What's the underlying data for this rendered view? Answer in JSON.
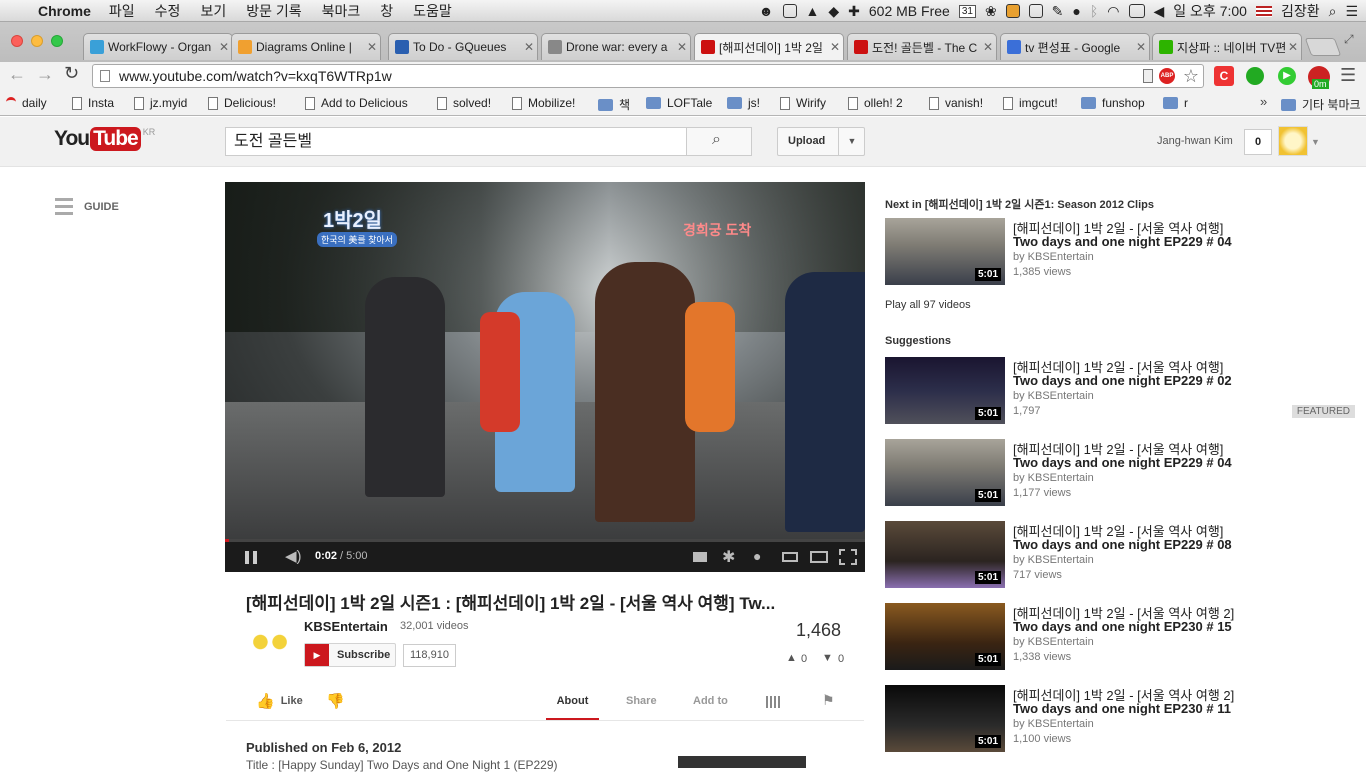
{
  "menubar": {
    "app": "Chrome",
    "items": [
      "파일",
      "수정",
      "보기",
      "방문 기록",
      "북마크",
      "창",
      "도움말"
    ],
    "free_mem": "602 MB Free",
    "calendar_day": "31",
    "clock": "일 오후 7:00",
    "user": "김장환"
  },
  "tabs": [
    {
      "title": "WorkFlowy - Organ",
      "color": "#3aa0d8"
    },
    {
      "title": "Diagrams Online |",
      "color": "#f0a030"
    },
    {
      "title": "To Do - GQueues",
      "color": "#2a5fb0"
    },
    {
      "title": "Drone war: every a",
      "color": "#888888"
    },
    {
      "title": "[해피선데이] 1박 2일",
      "color": "#cc1111"
    },
    {
      "title": "도전! 골든벨 - The C",
      "color": "#cc1111"
    },
    {
      "title": "tv 편성표 - Google",
      "color": "#3b6fd8"
    },
    {
      "title": "지상파 :: 네이버 TV편",
      "color": "#2db400"
    }
  ],
  "omnibox": {
    "url": "www.youtube.com/watch?v=kxqT6WTRp1w"
  },
  "bookmarks": [
    {
      "label": "daily",
      "kind": "page"
    },
    {
      "label": "Insta",
      "kind": "page"
    },
    {
      "label": "jz.myid",
      "kind": "page"
    },
    {
      "label": "Delicious!",
      "kind": "page"
    },
    {
      "label": "Add to Delicious",
      "kind": "page"
    },
    {
      "label": "solved!",
      "kind": "page"
    },
    {
      "label": "Mobilize!",
      "kind": "page"
    },
    {
      "label": "책",
      "kind": "folder"
    },
    {
      "label": "LOFTale",
      "kind": "folder"
    },
    {
      "label": "js!",
      "kind": "folder"
    },
    {
      "label": "Wirify",
      "kind": "page"
    },
    {
      "label": "olleh! 2",
      "kind": "page"
    },
    {
      "label": "vanish!",
      "kind": "page"
    },
    {
      "label": "imgcut!",
      "kind": "page"
    },
    {
      "label": "funshop",
      "kind": "folder"
    },
    {
      "label": "r",
      "kind": "folder"
    }
  ],
  "bookmarks_more": "»",
  "bookmarks_other": "기타 북마크",
  "ext_badge": "0m",
  "yt": {
    "logo_you": "You",
    "logo_tube": "Tube",
    "region": "KR",
    "search_value": "도전 골든벨",
    "upload": "Upload",
    "user_name": "Jang-hwan Kim",
    "notif_count": "0",
    "guide": "GUIDE"
  },
  "player": {
    "time_current": "0:02",
    "time_total": "/ 5:00",
    "overlay_logo": "1박2일",
    "overlay_sub": "한국의 美를 찾아서",
    "overlay_right": "경희궁 도착",
    "progress": 0.007
  },
  "video": {
    "title": "[해피선데이] 1박 2일 시즌1 : [해피선데이] 1박 2일 - [서울 역사 여행] Tw...",
    "channel": "KBSEntertain",
    "channel_videos": "32,001 videos",
    "subscribe": "Subscribe",
    "subscribers": "118,910",
    "views": "1,468",
    "likes": "0",
    "dislikes": "0",
    "like_label": "Like",
    "tabs": [
      "About",
      "Share",
      "Add to"
    ],
    "published": "Published on Feb 6, 2012",
    "desc_line": "Title : [Happy Sunday] Two Days and One Night 1 (EP229)"
  },
  "sidebar": {
    "next_in": "Next in [해피선데이] 1박 2일 시즌1: Season 2012 Clips",
    "play_all": "Play all 97 videos",
    "suggestions_label": "Suggestions",
    "next_item": {
      "t1": "[해피선데이] 1박 2일 - [서울 역사 여행]",
      "t2": "Two days and one night EP229 # 04",
      "by": "by KBSEntertain",
      "views": "1,385 views",
      "dur": "5:01"
    },
    "items": [
      {
        "t1": "[해피선데이] 1박 2일 - [서울 역사 여행]",
        "t2": "Two days and one night EP229 # 02",
        "by": "by KBSEntertain",
        "views": "1,797",
        "dur": "5:01",
        "featured": "FEATURED"
      },
      {
        "t1": "[해피선데이] 1박 2일 - [서울 역사 여행]",
        "t2": "Two days and one night EP229 # 04",
        "by": "by KBSEntertain",
        "views": "1,177 views",
        "dur": "5:01",
        "featured": ""
      },
      {
        "t1": "[해피선데이] 1박 2일 - [서울 역사 여행]",
        "t2": "Two days and one night EP229 # 08",
        "by": "by KBSEntertain",
        "views": "717 views",
        "dur": "5:01",
        "featured": ""
      },
      {
        "t1": "[해피선데이] 1박 2일 - [서울 역사 여행 2]",
        "t2": "Two days and one night EP230 # 15",
        "by": "by KBSEntertain",
        "views": "1,338 views",
        "dur": "5:01",
        "featured": ""
      },
      {
        "t1": "[해피선데이] 1박 2일 - [서울 역사 여행 2]",
        "t2": "Two days and one night EP230 # 11",
        "by": "by KBSEntertain",
        "views": "1,100 views",
        "dur": "5:01",
        "featured": ""
      }
    ]
  },
  "colors": {
    "yt_red": "#cc181e",
    "accent_blue": "#1c62b9"
  }
}
